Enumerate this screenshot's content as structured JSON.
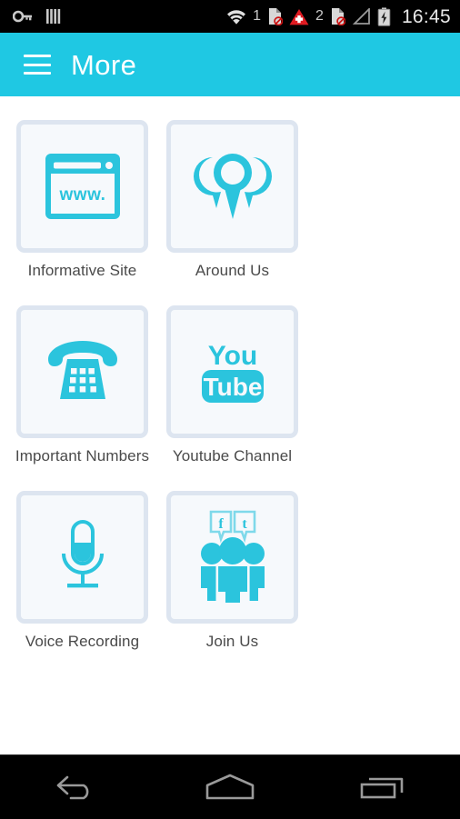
{
  "statusbar": {
    "left_icons": [
      {
        "name": "vpn-key-icon",
        "label": "vpn-key"
      },
      {
        "name": "barcode-icon",
        "label": "barcode"
      }
    ],
    "right_icons": [
      {
        "name": "wifi-icon",
        "label": "wifi"
      },
      {
        "name": "sim1-label",
        "label": "1"
      },
      {
        "name": "sim-card-disabled-icon",
        "label": "sim-disabled"
      },
      {
        "name": "alert-triangle-icon",
        "label": "alert"
      },
      {
        "name": "sim2-label",
        "label": "2"
      },
      {
        "name": "sim-card-disabled-icon-2",
        "label": "sim-disabled"
      },
      {
        "name": "signal-bars-icon",
        "label": "no-signal"
      },
      {
        "name": "battery-charging-icon",
        "label": "battery-charging"
      }
    ],
    "sim1": "1",
    "sim2": "2",
    "time": "16:45",
    "bg_color": "#000000"
  },
  "appbar": {
    "title": "More",
    "menu_icon": "hamburger-icon",
    "bg_color": "#1fc8e3",
    "text_color": "#ffffff"
  },
  "theme": {
    "accent": "#2bc4dd",
    "accent_light": "#7fd9ea",
    "tile_border": "#dde5f0",
    "tile_fill": "#f6f9fc",
    "label_color": "#4a4a4a",
    "page_bg": "#ffffff"
  },
  "grid": {
    "tiles": [
      {
        "label": "Informative Site",
        "icon": "browser-www-icon",
        "name": "tile-informative-site"
      },
      {
        "label": "Around Us",
        "icon": "map-pins-icon",
        "name": "tile-around-us"
      },
      {
        "label": "Important Numbers",
        "icon": "telephone-icon",
        "name": "tile-important-numbers"
      },
      {
        "label": "Youtube Channel",
        "icon": "youtube-logo-icon",
        "name": "tile-youtube-channel"
      },
      {
        "label": "Voice Recording",
        "icon": "microphone-icon",
        "name": "tile-voice-recording"
      },
      {
        "label": "Join Us",
        "icon": "social-people-icon",
        "name": "tile-join-us"
      }
    ],
    "browser_icon_text": "www.",
    "youtube_text_top": "You",
    "youtube_text_bottom": "Tube",
    "facebook_letter": "f",
    "twitter_letter": "t"
  },
  "navbar": {
    "buttons": [
      {
        "name": "nav-back-button",
        "label": "Back"
      },
      {
        "name": "nav-home-button",
        "label": "Home"
      },
      {
        "name": "nav-recents-button",
        "label": "Recents"
      }
    ],
    "bg_color": "#000000",
    "icon_color": "#9a9a9a"
  }
}
